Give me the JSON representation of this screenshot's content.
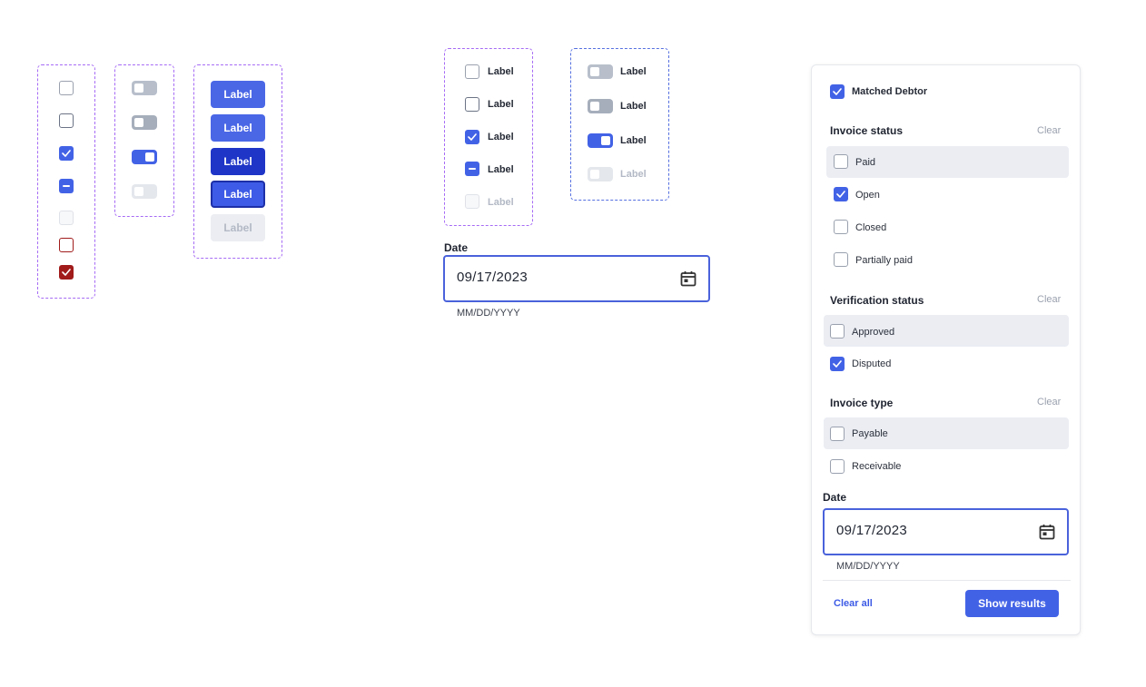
{
  "checkbox_column": {
    "states": [
      "default",
      "hover",
      "checked",
      "indeterminate",
      "disabled",
      "error",
      "error-checked"
    ]
  },
  "toggle_column": {
    "states": [
      "off",
      "off-hover",
      "on",
      "disabled"
    ]
  },
  "button_column": {
    "labels": [
      "Label",
      "Label",
      "Label",
      "Label",
      "Label"
    ]
  },
  "checkbox_labeled": {
    "labels": [
      "Label",
      "Label",
      "Label",
      "Label",
      "Label"
    ]
  },
  "toggle_labeled": {
    "labels": [
      "Label",
      "Label",
      "Label",
      "Label"
    ]
  },
  "date_field": {
    "label": "Date",
    "value": "09/17/2023",
    "hint": "MM/DD/YYYY"
  },
  "filter_panel": {
    "matched_debtor": {
      "label": "Matched Debtor",
      "checked": true
    },
    "invoice_status": {
      "title": "Invoice status",
      "clear": "Clear",
      "options": [
        {
          "label": "Paid",
          "checked": false
        },
        {
          "label": "Open",
          "checked": true
        },
        {
          "label": "Closed",
          "checked": false
        },
        {
          "label": "Partially paid",
          "checked": false
        }
      ]
    },
    "verification_status": {
      "title": "Verification status",
      "clear": "Clear",
      "options": [
        {
          "label": "Approved",
          "checked": false
        },
        {
          "label": "Disputed",
          "checked": true
        }
      ]
    },
    "invoice_type": {
      "title": "Invoice type",
      "clear": "Clear",
      "options": [
        {
          "label": "Payable",
          "checked": false
        },
        {
          "label": "Receivable",
          "checked": false
        }
      ]
    },
    "date": {
      "label": "Date",
      "value": "09/17/2023",
      "hint": "MM/DD/YYYY"
    },
    "footer": {
      "clear_all": "Clear all",
      "show_results": "Show results"
    }
  },
  "colors": {
    "primary": "#4262e6",
    "primary_dark": "#1f35c7",
    "error": "#a11b1b",
    "dashed_purple": "#a66bf5",
    "dashed_blue": "#5670e0"
  }
}
